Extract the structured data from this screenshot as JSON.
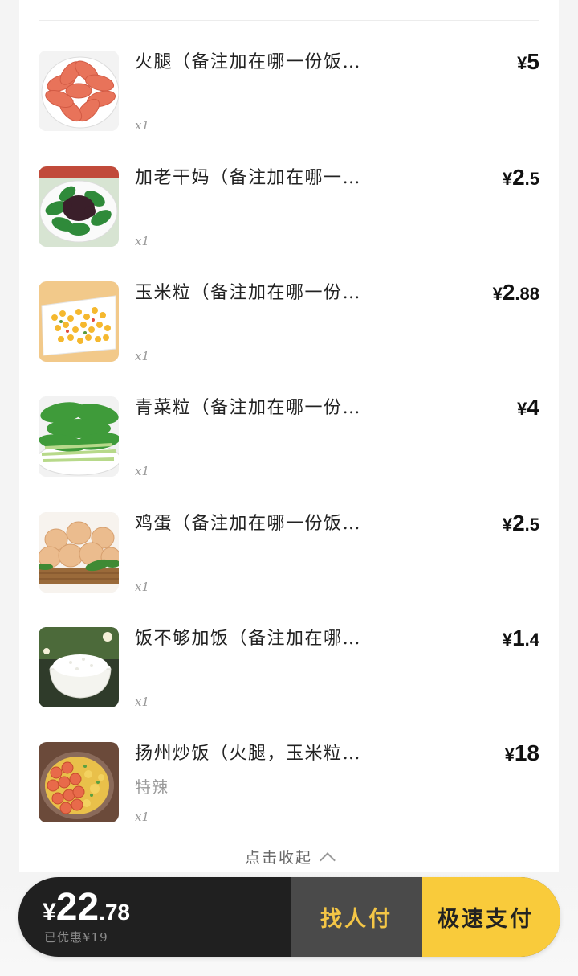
{
  "order": {
    "items": [
      {
        "name": "火腿（备注加在哪一份饭里炒）",
        "price_currency": "¥",
        "price_int": "5",
        "price_dec": "",
        "spec": "",
        "qty": "x1",
        "image": "ham-slices"
      },
      {
        "name": "加老干妈（备注加在哪一份饭里…",
        "price_currency": "¥",
        "price_int": "2",
        "price_dec": ".5",
        "spec": "",
        "qty": "x1",
        "image": "greens-with-chili"
      },
      {
        "name": "玉米粒（备注加在哪一份饭里炒）",
        "price_currency": "¥",
        "price_int": "2",
        "price_dec": ".88",
        "spec": "",
        "qty": "x1",
        "image": "corn-kernels"
      },
      {
        "name": "青菜粒（备注加在哪一份饭里炒）",
        "price_currency": "¥",
        "price_int": "4",
        "price_dec": "",
        "spec": "",
        "qty": "x1",
        "image": "green-vegetables"
      },
      {
        "name": "鸡蛋（备注加在哪一份饭里炒）",
        "price_currency": "¥",
        "price_int": "2",
        "price_dec": ".5",
        "spec": "",
        "qty": "x1",
        "image": "eggs-basket"
      },
      {
        "name": "饭不够加饭（备注加在哪份饭里…",
        "price_currency": "¥",
        "price_int": "1",
        "price_dec": ".4",
        "spec": "",
        "qty": "x1",
        "image": "rice-bowl"
      },
      {
        "name": "扬州炒饭（火腿，玉米粒，青瓜…",
        "price_currency": "¥",
        "price_int": "18",
        "price_dec": "",
        "spec": "特辣",
        "qty": "x1",
        "image": "fried-rice"
      }
    ],
    "collapse_label": "点击收起"
  },
  "checkout": {
    "total_currency": "¥",
    "total_int": "22",
    "total_dec": ".78",
    "discount_text": "已优惠¥19",
    "friend_pay_label": "找人付",
    "fast_pay_label": "极速支付"
  },
  "colors": {
    "bar_dark": "#202020",
    "friend_button": "#4a4a4a",
    "friend_text": "#f4c646",
    "pay_button": "#f9cb3b"
  }
}
